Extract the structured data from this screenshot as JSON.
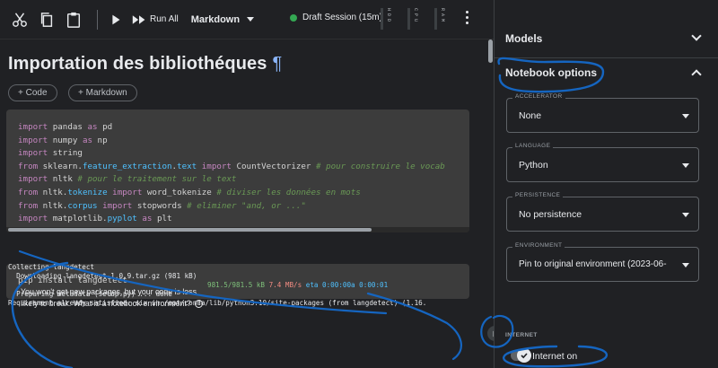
{
  "toolbar": {
    "icons": [
      "scissors-icon",
      "copy-icon",
      "paste-icon",
      "run-icon",
      "run-all-icon"
    ],
    "run_all_label": "Run All",
    "cell_mode": "Markdown",
    "session_status": "Draft Session (15m)",
    "meters": [
      {
        "label": "H D D"
      },
      {
        "label": "C P U"
      },
      {
        "label": "R A M"
      }
    ],
    "session_color": "#34a853"
  },
  "notebook": {
    "heading": "Importation des bibliothéques",
    "pilcrow": "¶",
    "add_code_label": "+ Code",
    "add_markdown_label": "+ Markdown",
    "code_lines": [
      "import pandas as pd",
      "import numpy as np",
      "import string",
      "from sklearn.feature_extraction.text import CountVectorizer # pour construire le vocab",
      "import nltk # pour le traitement sur le text",
      "from nltk.tokenize import word_tokenize # diviser les données en mots",
      "from nltk.corpus import stopwords # eliminer \"and, or ...\"",
      "import matplotlib.pyplot as plt"
    ],
    "cell2_code": "pip install langdetect",
    "output": {
      "line1": "Collecting langdetect",
      "line2": "  Downloading langdetect-1.0.9.tar.gz (981 kB)",
      "progress_sizes": "981.5/981.5 kB",
      "progress_speed": "7.4 MB/s",
      "progress_eta": "eta 0:00:00a 0:00:01",
      "line4": "  Preparing metadata (setup.py) ... done",
      "line5": "Requirement already satisfied: six in /opt/conda/lib/python3.10/site-packages (from langdetect) (1.16."
    }
  },
  "panel": {
    "models_label": "Models",
    "notebook_options_label": "Notebook options",
    "accelerator": {
      "label": "ACCELERATOR",
      "value": "None"
    },
    "language": {
      "label": "LANGUAGE",
      "value": "Python"
    },
    "persistence": {
      "label": "PERSISTENCE",
      "value": "No persistence"
    },
    "environment": {
      "label": "ENVIRONMENT",
      "value": "Pin to original environment (2023-06-"
    },
    "environment_note": "You won't get new packages, but your code is less likely to break. What is a notebook environment?",
    "internet_label": "INTERNET",
    "internet_value": "Internet on"
  },
  "colors": {
    "annotation": "#1565c0",
    "background": "#202124",
    "code_bg": "#3c3c3c"
  }
}
